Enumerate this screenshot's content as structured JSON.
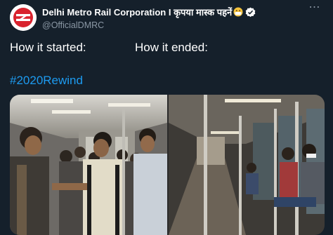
{
  "tweet": {
    "display_name": "Delhi Metro Rail Corporation I कृपया मास्क पहनें",
    "handle": "@OfficialDMRC",
    "text_left": "How it started:",
    "text_right": "How it ended:",
    "hashtag": "#2020Rewind",
    "more_icon": "⋯"
  },
  "media": {
    "left_alt": "crowded metro coach",
    "right_alt": "sparse metro coach with masked passengers"
  },
  "colors": {
    "background": "#15202b",
    "link": "#1d9bf0",
    "verified": "#ffffff",
    "avatar_logo": "#d9232e"
  }
}
